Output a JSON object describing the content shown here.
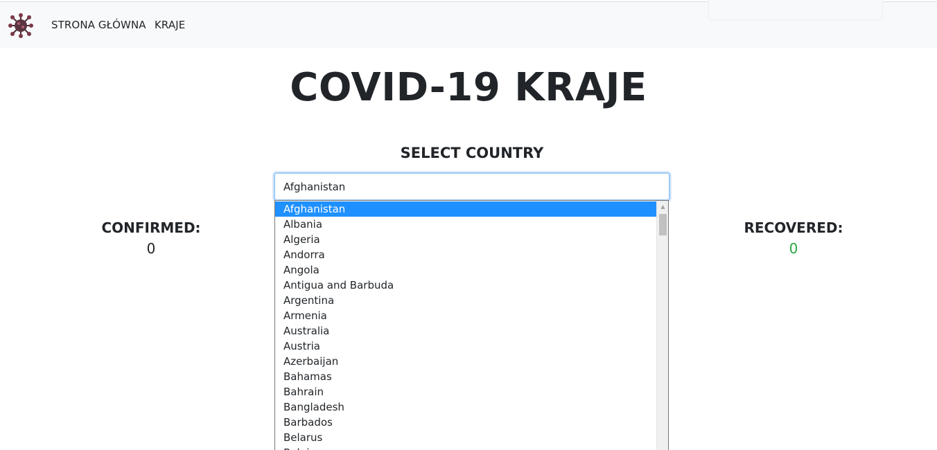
{
  "nav": {
    "logo_icon": "virus-icon",
    "links": [
      "STRONA GŁÓWNA",
      "KRAJE"
    ]
  },
  "title": "COVID-19 KRAJE",
  "select": {
    "heading": "SELECT COUNTRY",
    "value": "Afghanistan",
    "options": [
      "Afghanistan",
      "Albania",
      "Algeria",
      "Andorra",
      "Angola",
      "Antigua and Barbuda",
      "Argentina",
      "Armenia",
      "Australia",
      "Austria",
      "Azerbaijan",
      "Bahamas",
      "Bahrain",
      "Bangladesh",
      "Barbados",
      "Belarus",
      "Belgium"
    ],
    "selected_index": 0,
    "highlight_color": "#1e90ff"
  },
  "stats": {
    "confirmed": {
      "label": "CONFIRMED:",
      "value": "0"
    },
    "recovered": {
      "label": "RECOVERED:",
      "value": "0",
      "color": "#28a745"
    }
  }
}
